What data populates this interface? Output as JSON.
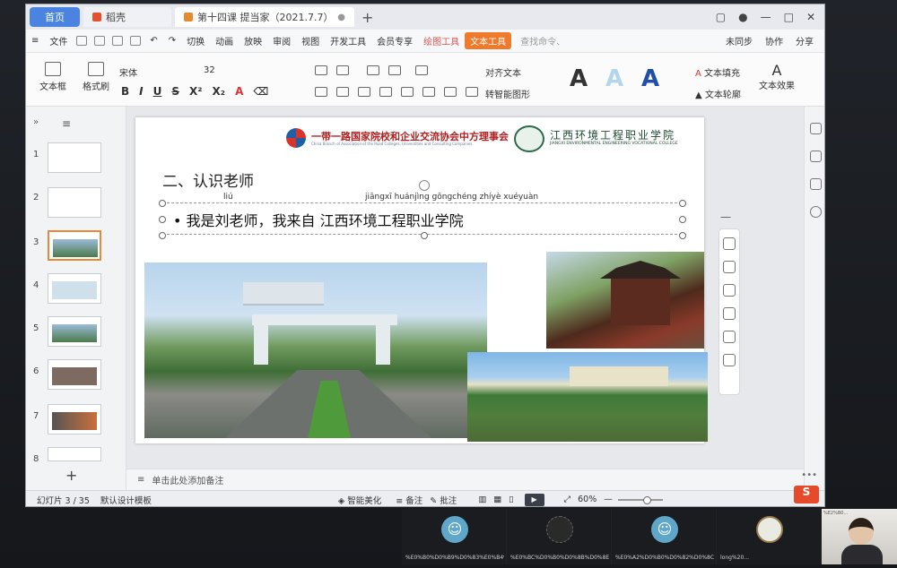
{
  "titlebar": {
    "home_tab": "首页",
    "wps_tab": "稻壳",
    "doc_tab": "第十四课 提当家（2021.7.7）",
    "new_tab_icon": "+"
  },
  "menu": {
    "file": "文件",
    "items": [
      "切换",
      "动画",
      "放映",
      "审阅",
      "视图",
      "开发工具",
      "会员专享"
    ],
    "drawing_tools": "绘图工具",
    "text_tools": "文本工具",
    "search_placeholder": "查找命令、",
    "sync": "未同步",
    "collab": "协作",
    "share": "分享"
  },
  "ribbon": {
    "textbox": "文本框",
    "format_painter": "格式刷",
    "font": "宋体",
    "size": "32",
    "align_text": "对齐文本",
    "smartart": "转智能图形",
    "text_fill": "文本填充",
    "text_outline": "文本轮廓",
    "text_effect": "文本效果",
    "style_letter": "A",
    "style_colors": [
      "#111111",
      "#b3d6ec",
      "#1f4fa8"
    ]
  },
  "thumbnails": [
    "1",
    "2",
    "3",
    "4",
    "5",
    "6",
    "7",
    "8"
  ],
  "slide": {
    "org1": "一带一路国家院校和企业交流协会中方理事会",
    "org1_sub": "China Branch of Association of the Road Colleges, Universities and Consulting Companies",
    "org2": "江西环境工程职业学院",
    "org2_sub": "JIANGXI ENVIRONMENTAL ENGINEERING VOCATIONAL COLLEGE",
    "title": "二、认识老师",
    "pinyin_liu": "liú",
    "pinyin_school": "jiāngxī huánjìng gōngchéng zhíyè xuéyuàn",
    "body": "我是刘老师，我来自 江西环境工程职业学院"
  },
  "notes": {
    "placeholder": "单击此处添加备注"
  },
  "status": {
    "slide_counter": "幻灯片 3 / 35",
    "template": "默认设计模板",
    "beautify": "智能美化",
    "notes": "备注",
    "comments": "批注",
    "zoom": "60%"
  },
  "participants": [
    {
      "name": "%E0%B0%D0%B9%D0%83%E0%B4%E0..."
    },
    {
      "name": "%E0%BC%D0%B0%D0%8B%D0%8E%D0..."
    },
    {
      "name": "%E0%A2%D0%B0%D0%82%D0%8C%..."
    },
    {
      "name": "long%20..."
    }
  ],
  "self_label": "%E2%B0..."
}
